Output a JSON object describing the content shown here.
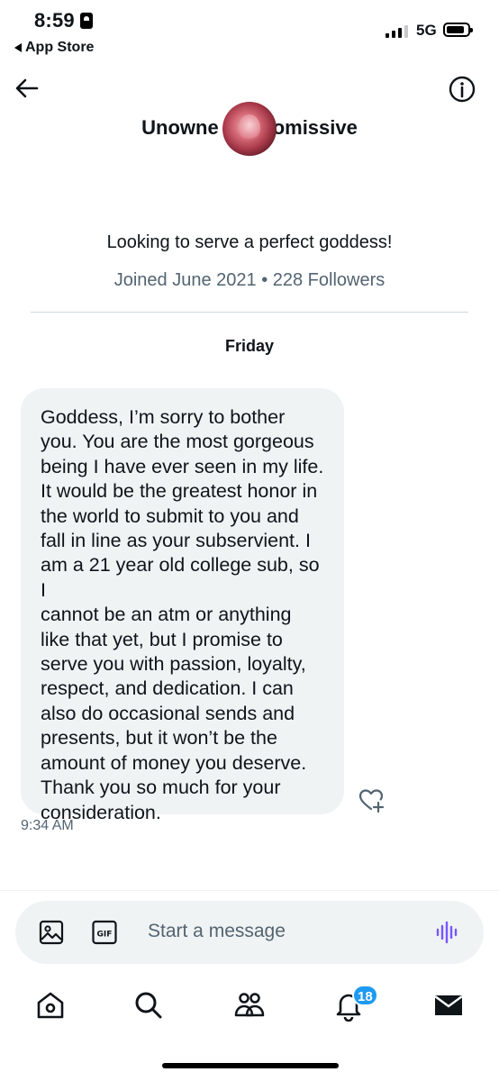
{
  "status_bar": {
    "time": "8:59",
    "back_app": "App Store",
    "network": "5G"
  },
  "header": {
    "title": "Unowned Submissive",
    "title_prefix": "Unowne",
    "title_suffix": "omissive"
  },
  "profile": {
    "bio": "Looking to serve a perfect goddess!",
    "meta": "Joined June 2021 • 228 Followers"
  },
  "conversation": {
    "day_label": "Friday",
    "message": {
      "text": "Goddess, I’m sorry to bother\nyou. You are the most gorgeous\nbeing I have ever seen in my life.\nIt would be the greatest honor in\nthe world to submit to you and\nfall in line as your subservient. I\nam a 21 year old college sub, so I\ncannot be an atm or anything\nlike that yet, but I promise to\nserve you with passion, loyalty,\nrespect, and dedication. I can\nalso do occasional sends and\npresents, but it won’t be the\namount of money you deserve.\nThank you so much for your\nconsideration.",
      "time": "9:34 AM"
    }
  },
  "composer": {
    "placeholder": "Start a message",
    "gif_label": "GIF"
  },
  "tab_bar": {
    "notifications_count": "18"
  },
  "colors": {
    "accent": "#1d9bf0",
    "voice": "#7856ff",
    "muted": "#536471",
    "bubble": "#eff3f4"
  },
  "icons": [
    "back-arrow-icon",
    "info-icon",
    "image-icon",
    "gif-icon",
    "voice-icon",
    "react-heart-icon",
    "home-icon",
    "search-icon",
    "people-icon",
    "bell-icon",
    "mail-icon"
  ]
}
